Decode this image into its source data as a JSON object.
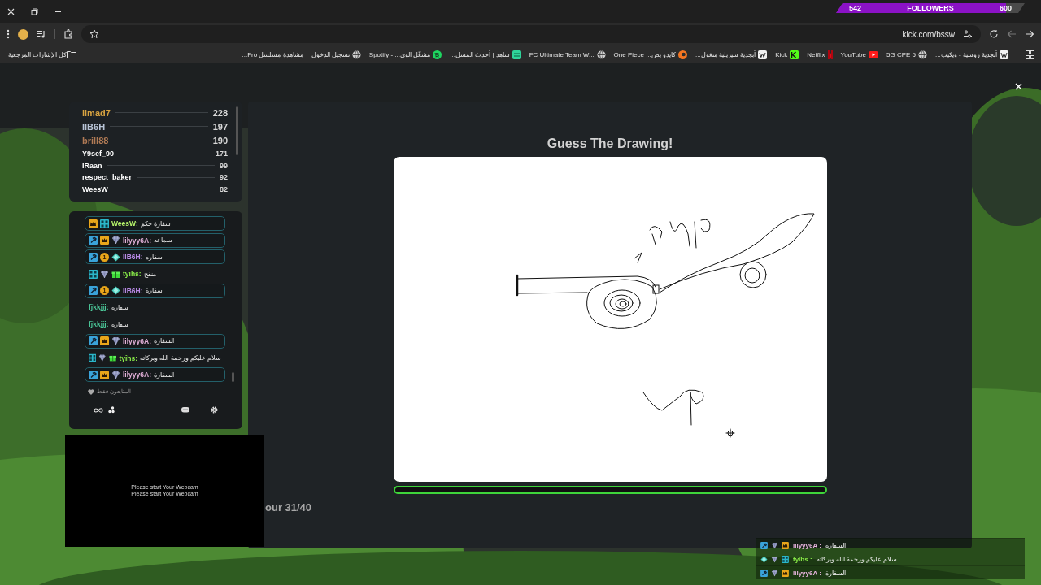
{
  "followers": {
    "current": "542",
    "label": "FOLLOWERS",
    "goal": "600",
    "level": 0.9
  },
  "toolbar": {
    "url": "kick.com/bssw"
  },
  "bookmarks": [
    {
      "label": "أبجدية روسية - ويكيب...",
      "kind": "wiki"
    },
    {
      "label": "5G CPE 5",
      "kind": "globe"
    },
    {
      "label": "YouTube",
      "kind": "youtube"
    },
    {
      "label": "Netflix",
      "kind": "netflix"
    },
    {
      "label": "Kick",
      "kind": "kick"
    },
    {
      "label": "أبجدية سيريلية منغول...",
      "kind": "wiki"
    },
    {
      "label": "كايدو يض... One Piece",
      "kind": "crunchyroll"
    },
    {
      "label": "FC Ultimate Team W...",
      "kind": "globe"
    },
    {
      "label": "شاهد | أحدث المسل...",
      "kind": "shahid"
    },
    {
      "label": "مشغّل الوي... - Spotify",
      "kind": "spotify"
    },
    {
      "label": "تسجيل الدخول",
      "kind": "globe"
    },
    {
      "label": "مشاهدة مسلسل Fro...",
      "kind": "plain"
    }
  ],
  "all_bookmarks": {
    "label": "كل الإشارات المرجعية"
  },
  "leaderboard": [
    {
      "name": "iimad7",
      "score": "228",
      "color": "#d9a441"
    },
    {
      "name": "IIB6H",
      "score": "197",
      "color": "#b8c4d6"
    },
    {
      "name": "brill88",
      "score": "190",
      "color": "#b07a55"
    },
    {
      "name": "Y9sef_90",
      "score": "171",
      "color": "#ffffff"
    },
    {
      "name": "IRaan",
      "score": "99",
      "color": "#ffffff"
    },
    {
      "name": "respect_baker",
      "score": "92",
      "color": "#ffffff"
    },
    {
      "name": "WeesW",
      "score": "82",
      "color": "#ffffff"
    }
  ],
  "chat": {
    "messages": [
      {
        "user": "WeesW:",
        "text": "سفارة حكم",
        "color": "#b7f56b",
        "highlighted": true,
        "badges": [
          {
            "kind": "crown"
          },
          {
            "kind": "og"
          }
        ]
      },
      {
        "user": "lilyyy6A:",
        "text": "سماعه",
        "color": "#e6b3dc",
        "highlighted": true,
        "badges": [
          {
            "kind": "mod"
          },
          {
            "kind": "crown"
          },
          {
            "kind": "diamond"
          }
        ]
      },
      {
        "user": "IIB6H:",
        "text": "سفاره",
        "color": "#b98ae6",
        "highlighted": true,
        "badges": [
          {
            "kind": "mod"
          },
          {
            "kind": "coin",
            "label": "1"
          },
          {
            "kind": "gem"
          }
        ]
      },
      {
        "user": "tyihs:",
        "text": "منفخ",
        "color": "#8cf04a",
        "highlighted": false,
        "badges": [
          {
            "kind": "og"
          },
          {
            "kind": "diamond"
          },
          {
            "kind": "gift"
          }
        ]
      },
      {
        "user": "IIB6H:",
        "text": "سفارة",
        "color": "#b98ae6",
        "highlighted": true,
        "badges": [
          {
            "kind": "mod"
          },
          {
            "kind": "coin",
            "label": "1"
          },
          {
            "kind": "gem"
          }
        ]
      },
      {
        "user": "fjkkjjj:",
        "text": "سفاره",
        "color": "#4cc99a",
        "highlighted": false
      },
      {
        "user": "fjkkjjj:",
        "text": "سفارة",
        "color": "#4cc99a",
        "highlighted": false
      },
      {
        "user": "lilyyy6A:",
        "text": "السفاره",
        "color": "#e6b3dc",
        "highlighted": true,
        "badges": [
          {
            "kind": "mod"
          },
          {
            "kind": "crown"
          },
          {
            "kind": "diamond"
          }
        ]
      },
      {
        "user": "tyihs:",
        "text": "سلام عليكم ورحمة الله وبركاته",
        "color": "#8cf04a",
        "highlighted": false,
        "badges": [
          {
            "kind": "og"
          },
          {
            "kind": "diamond"
          },
          {
            "kind": "gift"
          }
        ]
      },
      {
        "user": "lilyyy6A:",
        "text": "السفارة",
        "color": "#e6b3dc",
        "highlighted": true,
        "badges": [
          {
            "kind": "mod"
          },
          {
            "kind": "crown"
          },
          {
            "kind": "diamond"
          }
        ]
      }
    ],
    "followers_only": "المتابعون فقط"
  },
  "webcam": {
    "lines": [
      "Please start Your Webcam",
      "Please start Your Webcam"
    ]
  },
  "game": {
    "title": "Guess The Drawing!",
    "round": "our 31/40"
  },
  "overlay_chat": [
    {
      "user": "lilyyy6A :",
      "text": "السفاره",
      "color": "#e6b3dc",
      "badges": [
        {
          "kind": "mod"
        },
        {
          "kind": "diamond"
        },
        {
          "kind": "crown"
        }
      ]
    },
    {
      "user": "tyihs :",
      "text": "سلام عليكم ورحمة الله وبركاته",
      "color": "#8cf04a",
      "badges": [
        {
          "kind": "gem"
        },
        {
          "kind": "diamond"
        },
        {
          "kind": "og"
        }
      ]
    },
    {
      "user": "lilyyy6A :",
      "text": "السفارة",
      "color": "#e6b3dc",
      "badges": [
        {
          "kind": "mod"
        },
        {
          "kind": "diamond"
        },
        {
          "kind": "crown"
        }
      ]
    }
  ]
}
